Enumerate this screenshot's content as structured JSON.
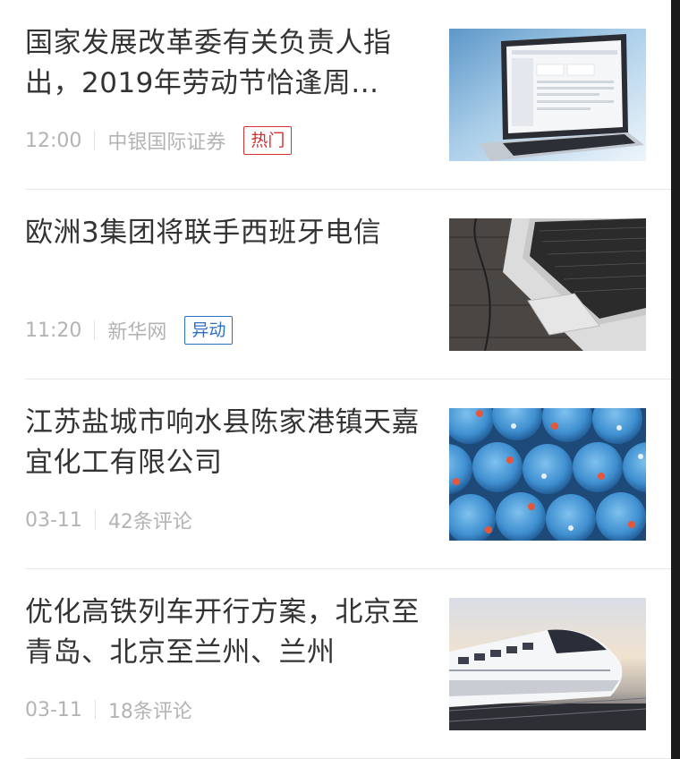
{
  "feed": {
    "items": [
      {
        "title": "国家发展改革委有关负责人指出，2019年劳动节恰逢周...",
        "time": "12:00",
        "source": "中银国际证券",
        "tag": "热门",
        "tag_color": "#d43030",
        "image_icon": "laptop-analytics-photo"
      },
      {
        "title": "欧洲3集团将联手西班牙电信",
        "time": "11:20",
        "source": "新华网",
        "tag": "异动",
        "tag_color": "#2d6fc4",
        "image_icon": "laptop-keyboard-photo"
      },
      {
        "title": "江苏盐城市响水县陈家港镇天嘉宜化工有限公司",
        "time": "03-11",
        "source": "42条评论",
        "image_icon": "blue-barrels-photo"
      },
      {
        "title": "优化高铁列车开行方案，北京至青岛、北京至兰州、兰州",
        "time": "03-11",
        "source": "18条评论",
        "image_icon": "high-speed-train-photo"
      }
    ]
  }
}
